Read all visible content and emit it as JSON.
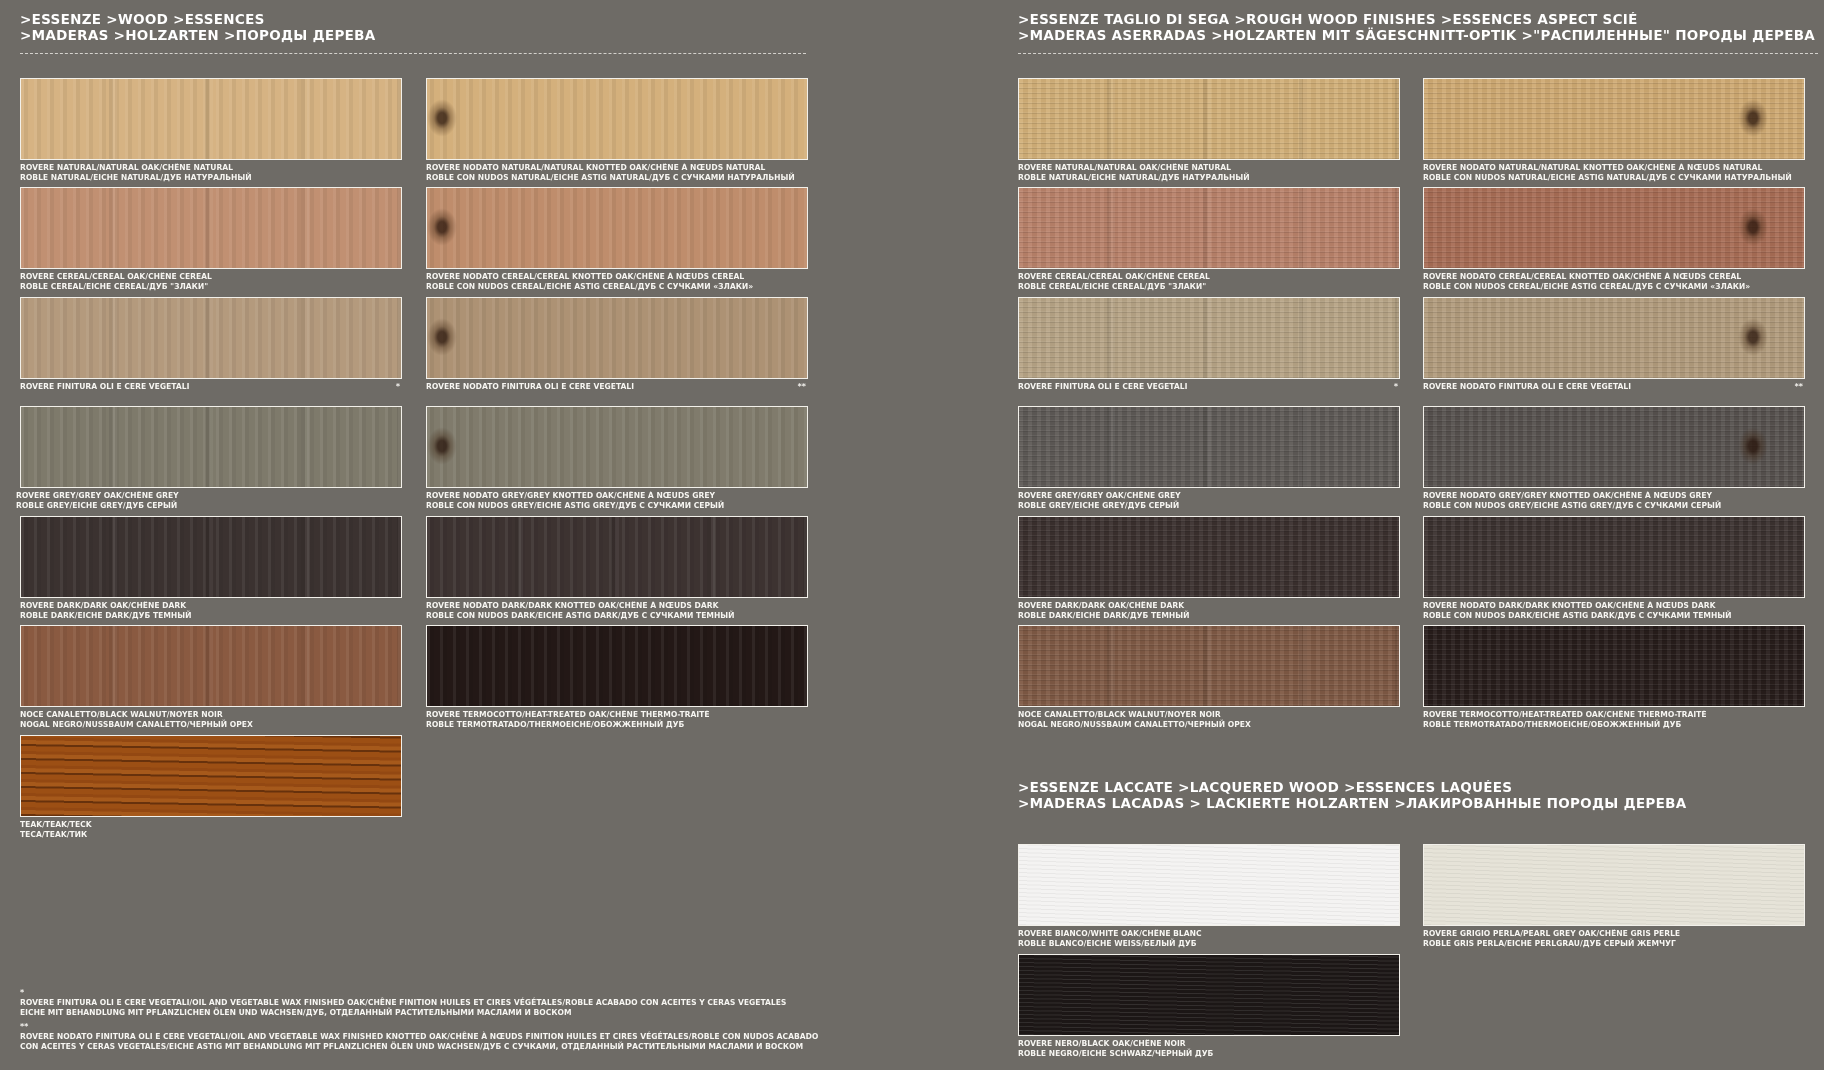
{
  "left_page": {
    "header": {
      "line1": ">ESSENZE >WOOD >ESSENCES",
      "line2": ">MADERAS >HOLZARTEN >ПОРОДЫ ДЕРЕВА"
    },
    "swatches": [
      {
        "line1": "ROVERE NATURAL/NATURAL OAK/CHÊNE NATURAL",
        "line2": "ROBLE NATURAL/EICHE NATURAL/ДУБ НАТУРАЛЬНЫЙ",
        "mark": "",
        "color": "#d6b383"
      },
      {
        "line1": "ROVERE NODATO NATURAL/NATURAL KNOTTED OAK/CHÊNE À NŒUDS NATURAL",
        "line2": "ROBLE CON NUDOS NATURAL/EICHE ASTIG NATURAL/ДУБ С СУЧКАМИ НАТУРАЛЬНЫЙ",
        "mark": "",
        "color": "#d4b07c"
      },
      {
        "line1": "ROVERE CEREAL/CEREAL OAK/CHÊNE CEREAL",
        "line2": "ROBLE CEREAL/EICHE CEREAL/ДУБ \"ЗЛАКИ\"",
        "mark": "",
        "color": "#c19072"
      },
      {
        "line1": "ROVERE NODATO CEREAL/CEREAL KNOTTED OAK/CHÊNE À NŒUDS CEREAL",
        "line2": "ROBLE CON NUDOS CEREAL/EICHE ASTIG CEREAL/ДУБ С СУЧКАМИ «ЗЛАКИ»",
        "mark": "",
        "color": "#bf8d6c"
      },
      {
        "line1": "ROVERE FINITURA OLI E CERE VEGETALI",
        "line2": "",
        "mark": "*",
        "color": "#b49a7d"
      },
      {
        "line1": "ROVERE NODATO FINITURA OLI E CERE VEGETALI",
        "line2": "",
        "mark": "**",
        "color": "#ad9274"
      },
      {
        "line1": "ROVERE GREY/GREY OAK/CHÊNE GREY",
        "line2": "ROBLE GREY/EICHE GREY/ДУБ СЕРЫЙ",
        "mark": "",
        "color": "#7e7a6b"
      },
      {
        "line1": "ROVERE NODATO GREY/GREY KNOTTED OAK/CHÊNE À NŒUDS GREY",
        "line2": "ROBLE CON NUDOS GREY/EICHE ASTIG GREY/ДУБ С СУЧКАМИ СЕРЫЙ",
        "mark": "",
        "color": "#807b6c"
      },
      {
        "line1": "ROVERE DARK/DARK OAK/CHÊNE DARK",
        "line2": "ROBLE DARK/EICHE DARK/ДУБ ТЕМНЫЙ",
        "mark": "",
        "color": "#3b3230"
      },
      {
        "line1": "ROVERE NODATO DARK/DARK KNOTTED OAK/CHÊNE À NŒUDS DARK",
        "line2": "ROBLE CON NUDOS DARK/EICHE ASTIG DARK/ДУБ С СУЧКАМИ ТЕМНЫЙ",
        "mark": "",
        "color": "#3d3331"
      },
      {
        "line1": "NOCE CANALETTO/BLACK WALNUT/NOYER NOIR",
        "line2": "NOGAL NEGRO/NUSSBAUM CANALETTO/ЧЕРНЫЙ ОРЕХ",
        "mark": "",
        "color": "#8a5a41"
      },
      {
        "line1": "ROVERE TERMOCOTTO/HEAT-TREATED OAK/CHÊNE THERMO-TRAITÉ",
        "line2": "ROBLE TERMOTRATADO/THERMOEICHE/ОБОЖЖЕННЫЙ ДУБ",
        "mark": "",
        "color": "#231816"
      },
      {
        "line1": "TEAK/TEAK/TECK",
        "line2": "TECA/TEAK/ТИК",
        "mark": "",
        "color": "#9c4f14"
      }
    ],
    "footnotes": [
      {
        "mark": "*",
        "line1": "ROVERE FINITURA OLI E CERE VEGETALI/OIL AND VEGETABLE WAX FINISHED OAK/CHÊNE FINITION HUILES ET CIRES VÉGÉTALES/ROBLE ACABADO CON ACEITES Y CERAS VEGETALES",
        "line2": "EICHE MIT BEHANDLUNG MIT PFLANZLICHEN ÖLEN UND WACHSEN/ДУБ, ОТДЕЛАННЫЙ РАСТИТЕЛЬНЫМИ МАСЛАМИ И ВОСКОМ"
      },
      {
        "mark": "**",
        "line1": "ROVERE NODATO FINITURA OLI E CERE VEGETALI/OIL AND VEGETABLE WAX FINISHED KNOTTED OAK/CHÊNE À NŒUDS FINITION HUILES ET CIRES VÉGÉTALES/ROBLE CON NUDOS ACABADO",
        "line2": "CON ACEITES Y CERAS VEGETALES/EICHE ASTIG MIT BEHANDLUNG MIT PFLANZLICHEN ÖLEN UND WACHSEN/ДУБ С СУЧКАМИ, ОТДЕЛАННЫЙ РАСТИТЕЛЬНЫМИ МАСЛАМИ И ВОСКОМ"
      }
    ]
  },
  "right_page": {
    "rough_header": {
      "line1": ">ESSENZE TAGLIO DI SEGA >ROUGH WOOD FINISHES >ESSENCES ASPECT SCIÉ",
      "line2": ">MADERAS ASERRADAS >HOLZARTEN MIT SÄGESCHNITT-OPTIK >\"РАСПИЛЕННЫЕ\" ПОРОДЫ ДЕРЕВА"
    },
    "rough_swatches": [
      {
        "line1": "ROVERE NATURAL/NATURAL OAK/CHÊNE NATURAL",
        "line2": "ROBLE NATURAL/EICHE NATURAL/ДУБ НАТУРАЛЬНЫЙ",
        "mark": "",
        "color": "#d2b079"
      },
      {
        "line1": "ROVERE NODATO NATURAL/NATURAL KNOTTED OAK/CHÊNE À NŒUDS NATURAL",
        "line2": "ROBLE CON NUDOS NATURAL/EICHE ASTIG NATURAL/ДУБ С СУЧКАМИ НАТУРАЛЬНЫЙ",
        "mark": "",
        "color": "#cfaa73"
      },
      {
        "line1": "ROVERE CEREAL/CEREAL OAK/CHÊNE CEREAL",
        "line2": "ROBLE CEREAL/EICHE CEREAL/ДУБ \"ЗЛАКИ\"",
        "mark": "",
        "color": "#b9826a"
      },
      {
        "line1": "ROVERE NODATO CEREAL/CEREAL KNOTTED OAK/CHÊNE À NŒUDS CEREAL",
        "line2": "ROBLE CON NUDOS CEREAL/EICHE ASTIG CEREAL/ДУБ С СУЧКАМИ «ЗЛАКИ»",
        "mark": "",
        "color": "#a86d55"
      },
      {
        "line1": "ROVERE FINITURA OLI E CERE VEGETALI",
        "line2": "",
        "mark": "*",
        "color": "#b7a486"
      },
      {
        "line1": "ROVERE NODATO FINITURA OLI E CERE VEGETALI",
        "line2": "",
        "mark": "**",
        "color": "#b29c7d"
      },
      {
        "line1": "ROVERE GREY/GREY OAK/CHÊNE GREY",
        "line2": "ROBLE GREY/EICHE GREY/ДУБ СЕРЫЙ",
        "mark": "",
        "color": "#5e5a56"
      },
      {
        "line1": "ROVERE NODATO GREY/GREY KNOTTED OAK/CHÊNE À NŒUDS GREY",
        "line2": "ROBLE CON NUDOS GREY/EICHE ASTIG GREY/ДУБ С СУЧКАМИ СЕРЫЙ",
        "mark": "",
        "color": "#56514e"
      },
      {
        "line1": "ROVERE DARK/DARK OAK/CHÊNE DARK",
        "line2": "ROBLE DARK/EICHE DARK/ДУБ ТЕМНЫЙ",
        "mark": "",
        "color": "#3a302e"
      },
      {
        "line1": "ROVERE NODATO DARK/DARK KNOTTED OAK/CHÊNE À NŒUDS DARK",
        "line2": "ROBLE CON NUDOS DARK/EICHE ASTIG DARK/ДУБ С СУЧКАМИ ТЕМНЫЙ",
        "mark": "",
        "color": "#3b3230"
      },
      {
        "line1": "NOCE CANALETTO/BLACK WALNUT/NOYER NOIR",
        "line2": "NOGAL NEGRO/NUSSBAUM CANALETTO/ЧЕРНЫЙ ОРЕХ",
        "mark": "",
        "color": "#7f5a45"
      },
      {
        "line1": "ROVERE TERMOCOTTO/HEAT-TREATED OAK/CHÊNE THERMO-TRAITÉ",
        "line2": "ROBLE TERMOTRATADO/THERMOEICHE/ОБОЖЖЕННЫЙ ДУБ",
        "mark": "",
        "color": "#271d1b"
      }
    ],
    "lacquered_header": {
      "line1": ">ESSENZE LACCATE >LACQUERED WOOD >ESSENCES LAQUÉES",
      "line2": ">MADERAS LACADAS > LACKIERTE HOLZARTEN >ЛАКИРОВАННЫЕ ПОРОДЫ ДЕРЕВА"
    },
    "lacquered_swatches": [
      {
        "line1": "ROVERE BIANCO/WHITE OAK/CHÊNE BLANC",
        "line2": "ROBLE BLANCO/EICHE WEIß/БЕЛЫЙ ДУБ",
        "mark": "",
        "color": "#f4f3f2"
      },
      {
        "line1": "ROVERE GRIGIO PERLA/PEARL GREY OAK/CHÊNE GRIS PERLE",
        "line2": "ROBLE GRIS PERLA/EICHE PERLGRAU/ДУБ СЕРЫЙ ЖЕМЧУГ",
        "mark": "",
        "color": "#e6e3d8"
      },
      {
        "line1": "ROVERE NERO/BLACK OAK/CHÊNE NOIR",
        "line2": "ROBLE NEGRO/EICHE SCHWARZ/ЧЕРНЫЙ ДУБ",
        "mark": "",
        "color": "#1c1716"
      }
    ]
  }
}
